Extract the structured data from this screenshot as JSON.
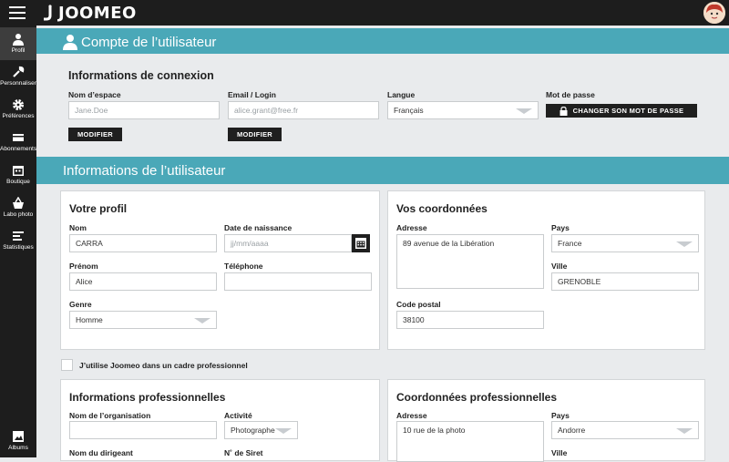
{
  "app": {
    "logo_text": "JOOMEO"
  },
  "sidebar": {
    "items": [
      {
        "label": "Profil"
      },
      {
        "label": "Personnaliser"
      },
      {
        "label": "Préférences"
      },
      {
        "label": "Abonnements"
      },
      {
        "label": "Boutique"
      },
      {
        "label": "Labo photo"
      },
      {
        "label": "Statistiques"
      },
      {
        "label": "Albums"
      }
    ]
  },
  "account": {
    "title": "Compte de l’utilisateur",
    "login_title": "Informations de connexion",
    "space_name": {
      "label": "Nom d’espace",
      "value": "Jane.Doe"
    },
    "email": {
      "label": "Email / Login",
      "value": "alice.grant@free.fr"
    },
    "language": {
      "label": "Langue",
      "value": "Français"
    },
    "password": {
      "label": "Mot de passe",
      "button": "CHANGER SON MOT DE PASSE"
    },
    "modify_label": "MODIFIER"
  },
  "user_info": {
    "title": "Informations de l’utilisateur",
    "profile": {
      "title": "Votre profil",
      "nom": {
        "label": "Nom",
        "value": "CARRA"
      },
      "birth": {
        "label": "Date de naissance",
        "placeholder": "jj/mm/aaaa"
      },
      "prenom": {
        "label": "Prénom",
        "value": "Alice"
      },
      "phone": {
        "label": "Téléphone",
        "value": ""
      },
      "genre": {
        "label": "Genre",
        "value": "Homme"
      }
    },
    "coords": {
      "title": "Vos coordonnées",
      "address": {
        "label": "Adresse",
        "value": "89 avenue de la Libération"
      },
      "country": {
        "label": "Pays",
        "value": "France"
      },
      "city": {
        "label": "Ville",
        "value": "GRENOBLE"
      },
      "postal": {
        "label": "Code postal",
        "value": "38100"
      }
    },
    "pro_checkbox_label": "J’utilise Joomeo dans un cadre professionnel",
    "pro_info": {
      "title": "Informations professionnelles",
      "org": {
        "label": "Nom de l’organisation",
        "value": ""
      },
      "activity": {
        "label": "Activité",
        "value": "Photographe"
      },
      "director": {
        "label": "Nom du dirigeant"
      },
      "siret": {
        "label": "N˚ de Siret"
      }
    },
    "pro_coords": {
      "title": "Coordonnées professionnelles",
      "address": {
        "label": "Adresse",
        "value": "10 rue de la photo"
      },
      "country": {
        "label": "Pays",
        "value": "Andorre"
      },
      "city": {
        "label": "Ville"
      }
    }
  },
  "colors": {
    "accent": "#4aa8b8",
    "dark": "#1d1d1d"
  }
}
